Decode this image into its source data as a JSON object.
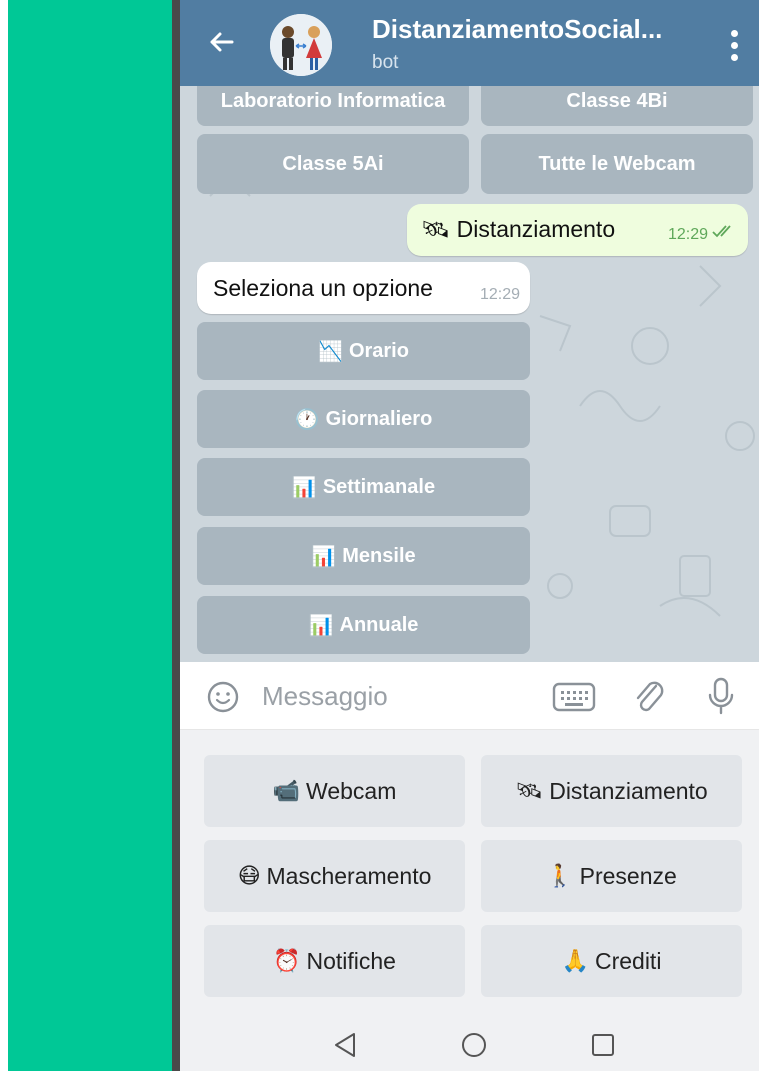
{
  "header": {
    "title": "DistanziamentoSocial...",
    "subtitle": "bot"
  },
  "chat": {
    "top_buttons": [
      {
        "label": "Laboratorio Informatica"
      },
      {
        "label": "Classe 4Bi"
      },
      {
        "label": "Classe 5Ai"
      },
      {
        "label": "Tutte le Webcam"
      }
    ],
    "outgoing": {
      "icon": "🛰",
      "text": "Distanziamento",
      "time": "12:29"
    },
    "incoming": {
      "text": "Seleziona un opzione",
      "time": "12:29"
    },
    "inline_buttons": [
      {
        "icon": "📉",
        "label": "Orario"
      },
      {
        "icon": "🕐",
        "label": "Giornaliero"
      },
      {
        "icon": "📊",
        "label": "Settimanale"
      },
      {
        "icon": "📊",
        "label": "Mensile"
      },
      {
        "icon": "📊",
        "label": "Annuale"
      }
    ]
  },
  "input": {
    "placeholder": "Messaggio"
  },
  "keyboard": [
    {
      "icon": "📹",
      "label": "Webcam"
    },
    {
      "icon": "🛰",
      "label": "Distanziamento"
    },
    {
      "icon": "😷",
      "label": "Mascheramento"
    },
    {
      "icon": "🚶",
      "label": "Presenze"
    },
    {
      "icon": "⏰",
      "label": "Notifiche"
    },
    {
      "icon": "🙏",
      "label": "Crediti"
    }
  ],
  "colors": {
    "side_bg": "#00c896",
    "header_bg": "#517da2",
    "chat_bg": "#cdd6dc",
    "inline_button_bg": "#a9b6bf",
    "outgoing_bubble": "#effdde"
  }
}
